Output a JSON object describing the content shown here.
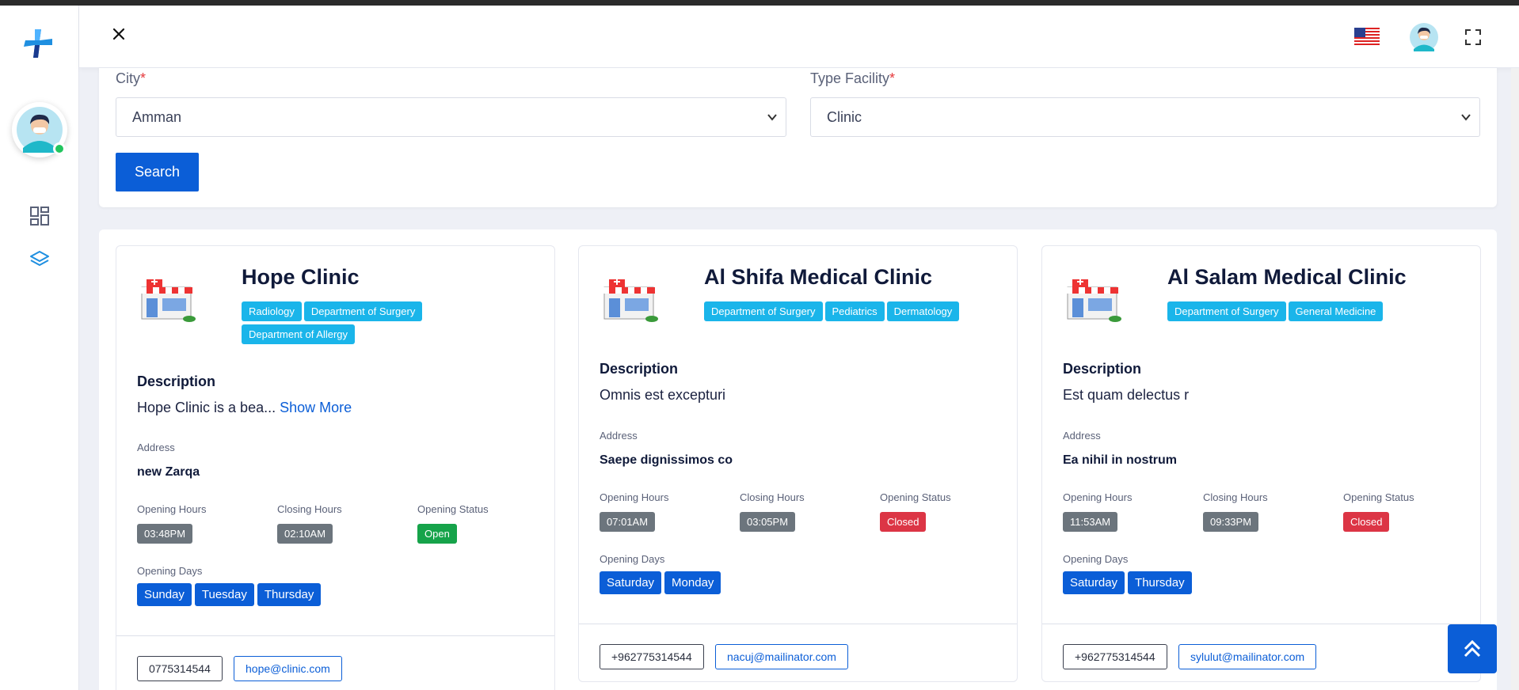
{
  "filters": {
    "city": {
      "label": "City",
      "required_mark": "*",
      "value": "Amman"
    },
    "type_facility": {
      "label": "Type Facility",
      "required_mark": "*",
      "value": "Clinic"
    },
    "search_label": "Search"
  },
  "icons": {
    "logo": "medical-cross-logo",
    "close": "close-icon",
    "flag": "us-flag-icon",
    "fullscreen": "fullscreen-icon",
    "dashboard": "dashboard-icon",
    "layers": "layers-icon",
    "scroll_top": "double-chevron-up-icon"
  },
  "labels": {
    "description": "Description",
    "address": "Address",
    "opening_hours": "Opening Hours",
    "closing_hours": "Closing Hours",
    "opening_status": "Opening Status",
    "opening_days": "Opening Days",
    "show_more": "Show More"
  },
  "clinics": [
    {
      "name": "Hope Clinic",
      "departments": [
        "Radiology",
        "Department of Surgery",
        "Department of Allergy"
      ],
      "description": "Hope Clinic is a bea...",
      "address": "new Zarqa",
      "opening_hours": "03:48PM",
      "closing_hours": "02:10AM",
      "status": "Open",
      "days": [
        "Sunday",
        "Tuesday",
        "Thursday"
      ],
      "phone": "0775314544",
      "email": "hope@clinic.com"
    },
    {
      "name": "Al Shifa Medical Clinic",
      "departments": [
        "Department of Surgery",
        "Pediatrics",
        "Dermatology"
      ],
      "description": "Omnis est excepturi",
      "address": "Saepe dignissimos co",
      "opening_hours": "07:01AM",
      "closing_hours": "03:05PM",
      "status": "Closed",
      "days": [
        "Saturday",
        "Monday"
      ],
      "phone": "+962775314544",
      "email": "nacuj@mailinator.com"
    },
    {
      "name": "Al Salam Medical Clinic",
      "departments": [
        "Department of Surgery",
        "General Medicine"
      ],
      "description": "Est quam delectus r",
      "address": "Ea nihil in nostrum",
      "opening_hours": "11:53AM",
      "closing_hours": "09:33PM",
      "status": "Closed",
      "days": [
        "Saturday",
        "Thursday"
      ],
      "phone": "+962775314544",
      "email": "sylulut@mailinator.com"
    }
  ],
  "colors": {
    "primary": "#0b5ed7",
    "tag": "#1ab5ea",
    "open": "#16a34a",
    "closed": "#dc3545",
    "time_badge": "#6c757d"
  }
}
